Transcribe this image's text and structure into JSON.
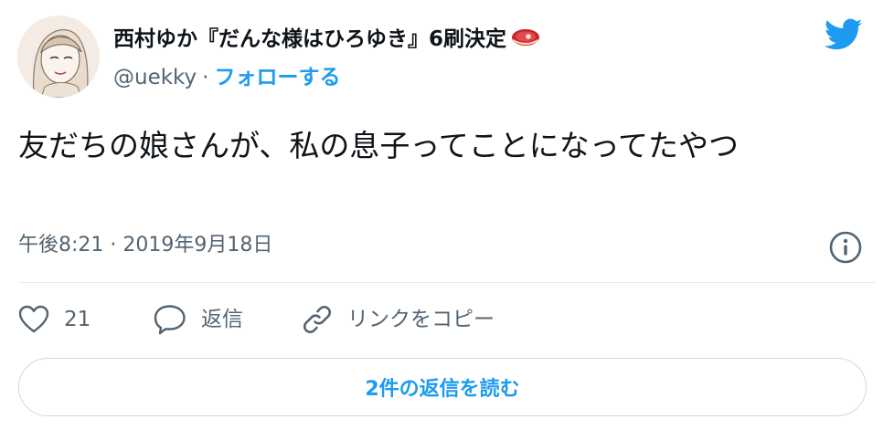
{
  "author": {
    "display_name": "西村ゆか『だんな様はひろゆき』6刷決定",
    "name_emoji": "meat-emoji",
    "handle": "@uekky",
    "separator": "·",
    "follow_label": "フォローする",
    "avatar": "avatar-illustration"
  },
  "tweet": {
    "text": "友だちの娘さんが、私の息子ってことになってたやつ",
    "timestamp": "午後8:21 · 2019年9月18日"
  },
  "actions": {
    "like_count": "21",
    "reply_label": "返信",
    "copy_link_label": "リンクをコピー"
  },
  "replies_button_label": "2件の返信を読む",
  "icons": {
    "brand": "twitter-bird-icon",
    "info": "info-icon",
    "like": "heart-icon",
    "reply": "speech-bubble-icon",
    "copy": "link-icon"
  },
  "colors": {
    "accent": "#1d9bf0",
    "text_primary": "#0f1419",
    "text_secondary": "#536471",
    "border": "#cfd9de"
  }
}
